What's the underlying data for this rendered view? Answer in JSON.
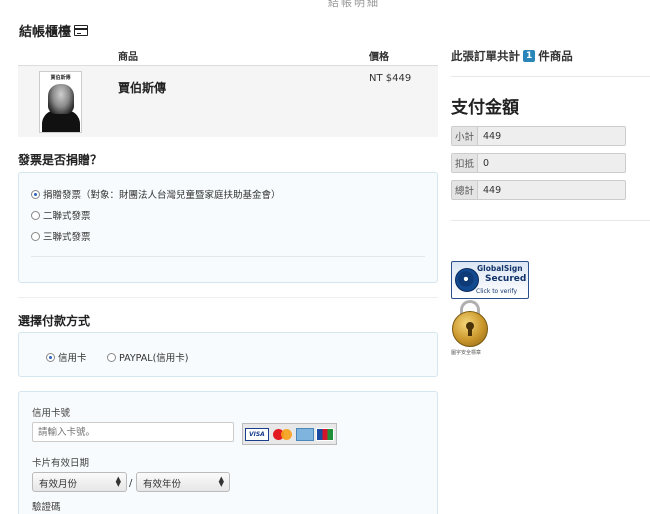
{
  "top_fragment": "結帳明細",
  "cart": {
    "title": "結帳櫃檯",
    "columns": {
      "product": "商品",
      "price": "價格"
    },
    "items": [
      {
        "name": "賈伯斯傳",
        "price": "NT $449",
        "cover_title": "賈伯斯傳"
      }
    ]
  },
  "invoice": {
    "title": "發票是否捐贈？",
    "options": [
      {
        "label": "捐贈發票（對象：財團法人台灣兒童暨家庭扶助基金會）",
        "checked": true
      },
      {
        "label": "二聯式發票",
        "checked": false
      },
      {
        "label": "三聯式發票",
        "checked": false
      }
    ]
  },
  "payment": {
    "title": "選擇付款方式",
    "options": [
      {
        "label": "信用卡",
        "checked": true
      },
      {
        "label": "PAYPAL(信用卡)",
        "checked": false
      }
    ]
  },
  "card_form": {
    "number_label": "信用卡號",
    "number_placeholder": "請輸入卡號。",
    "expiry_label": "卡片有效日期",
    "month_select": "有效月份",
    "year_select": "有效年份",
    "separator": "/",
    "cvv_label": "驗證碼",
    "card_logos": [
      "VISA",
      "MasterCard",
      "American Express",
      "JCB"
    ]
  },
  "summary": {
    "prefix": "此張訂單共計",
    "count": "1",
    "suffix": "件商品",
    "pay_title": "支付金額",
    "rows": [
      {
        "label": "小計",
        "value": "449"
      },
      {
        "label": "扣抵",
        "value": "0"
      },
      {
        "label": "總計",
        "value": "449"
      }
    ]
  },
  "badges": {
    "globalsign_brand": "GlobalSign",
    "globalsign_secured": "Secured",
    "globalsign_verify": "Click to verify",
    "seal_caption": "圖字安全標章"
  },
  "colors": {
    "accent": "#2a86b8",
    "panel_bg": "#f7fbfd",
    "panel_border": "#d6e6ee"
  }
}
